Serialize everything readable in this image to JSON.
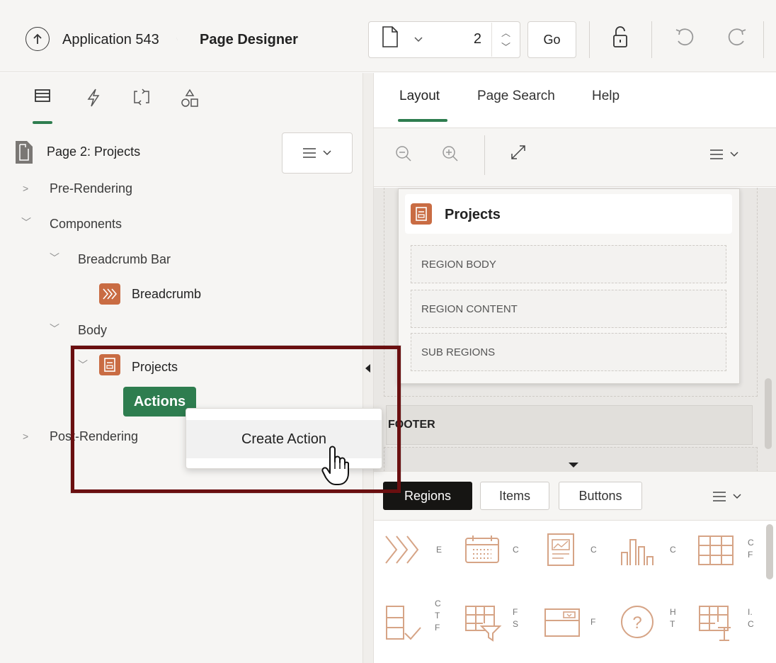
{
  "header": {
    "app_name": "Application 543",
    "page_designer": "Page Designer",
    "page_number": "2",
    "go_label": "Go"
  },
  "left_panel": {
    "tabs": [
      "rendering-tab",
      "dynamic-actions-tab",
      "processing-tab",
      "shared-components-tab"
    ],
    "tree": {
      "page": "Page 2: Projects",
      "pre_rendering": "Pre-Rendering",
      "components": "Components",
      "breadcrumb_bar": "Breadcrumb Bar",
      "breadcrumb": "Breadcrumb",
      "body": "Body",
      "projects": "Projects",
      "actions": "Actions",
      "post_rendering": "Post-Rendering"
    },
    "context_menu": {
      "create_action": "Create Action"
    }
  },
  "right_panel": {
    "tabs": {
      "layout": "Layout",
      "page_search": "Page Search",
      "help": "Help"
    },
    "canvas": {
      "region_title": "Projects",
      "region_body": "REGION BODY",
      "region_content": "REGION CONTENT",
      "sub_regions": "SUB REGIONS",
      "footer": "FOOTER"
    },
    "gallery_tabs": {
      "regions": "Regions",
      "items": "Items",
      "buttons": "Buttons"
    },
    "gallery_labels": [
      [
        "E"
      ],
      [
        "C"
      ],
      [
        "C"
      ],
      [
        "C"
      ],
      [
        "C",
        "F"
      ],
      [
        "C",
        "T",
        "F"
      ],
      [
        "F",
        "S"
      ],
      [
        "F"
      ],
      [
        "H",
        "T"
      ],
      [
        "I.",
        "C"
      ]
    ]
  },
  "colors": {
    "accent_green": "#2e7d4f",
    "region_orange": "#c96c43",
    "highlight_maroon": "#6a0f10",
    "active_tab_black": "#161513"
  }
}
